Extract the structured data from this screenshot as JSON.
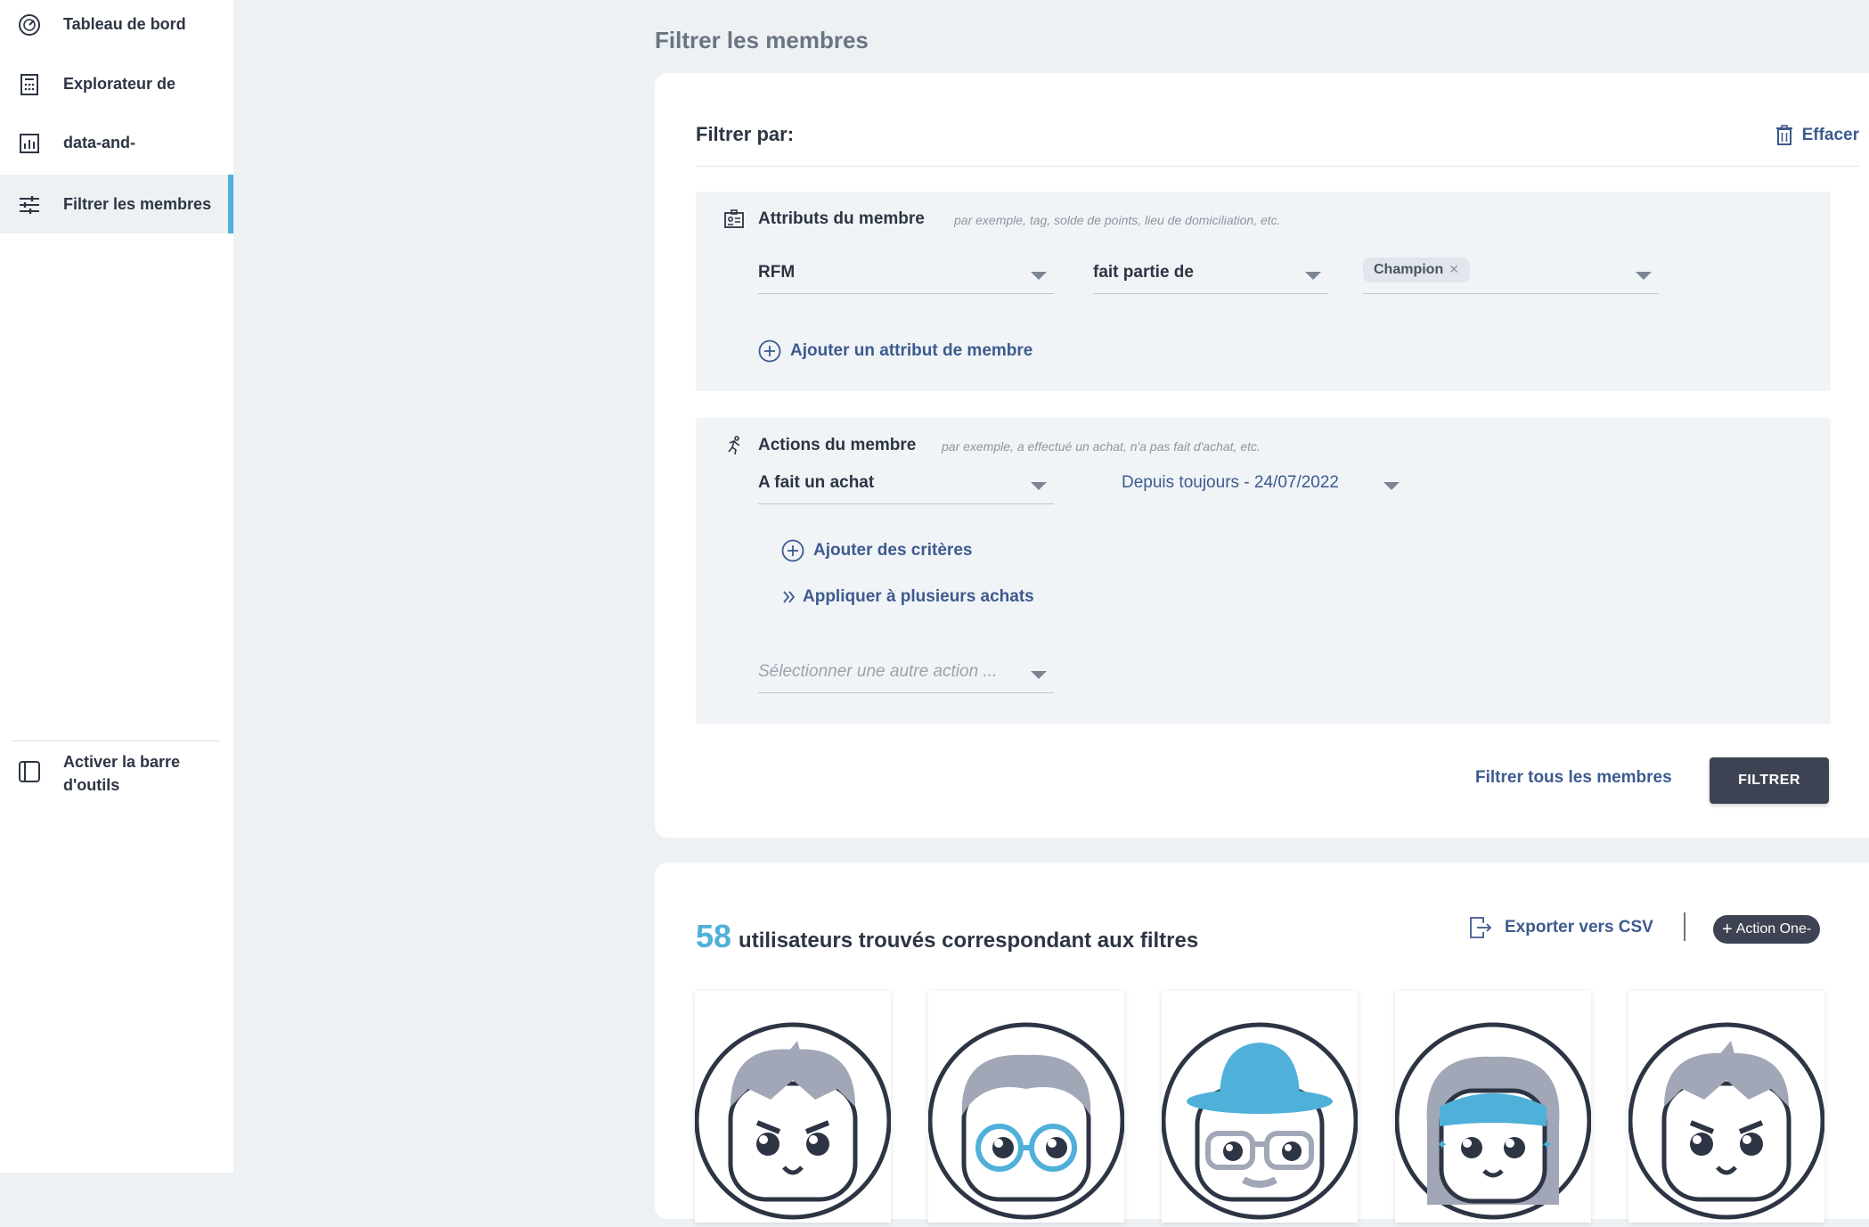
{
  "sidebar": {
    "items": [
      {
        "label": "Tableau de bord",
        "icon": "dashboard-gauge-icon"
      },
      {
        "label": "Explorateur de",
        "icon": "calculator-icon"
      },
      {
        "label": "data-and-",
        "icon": "bar-chart-icon"
      },
      {
        "label": "Filtrer les membres",
        "icon": "sliders-icon",
        "active": true
      }
    ],
    "toolbar_toggle": {
      "label": "Activer la barre d'outils",
      "icon": "sidebar-panel-icon"
    }
  },
  "page": {
    "title": "Filtrer les membres"
  },
  "filter": {
    "heading": "Filtrer par:",
    "clear_label": "Effacer",
    "attributes": {
      "title": "Attributs du membre",
      "hint": "par exemple, tag, solde de points, lieu de domiciliation, etc.",
      "field": "RFM",
      "operator": "fait partie de",
      "value_chip": "Champion",
      "add_label": "Ajouter un attribut de membre"
    },
    "actions": {
      "title": "Actions du membre",
      "hint": "par exemple, a effectué un achat, n'a pas fait d'achat, etc.",
      "action": "A fait un achat",
      "date_range": "Depuis toujours - 24/07/2022",
      "add_criteria_label": "Ajouter des critères",
      "apply_multiple_label": "Appliquer à plusieurs achats",
      "other_action_placeholder": "Sélectionner une autre action ..."
    },
    "filter_all_label": "Filtrer tous les membres",
    "filter_button_label": "FILTRER"
  },
  "results": {
    "count": "58",
    "count_text": "utilisateurs trouvés correspondant aux filtres",
    "export_label": "Exporter vers CSV",
    "action_button_label": "Action One-",
    "avatars": [
      "avatar-spiky-hair",
      "avatar-glasses",
      "avatar-blue-hat",
      "avatar-blue-mask",
      "avatar-spiky-hair"
    ]
  }
}
